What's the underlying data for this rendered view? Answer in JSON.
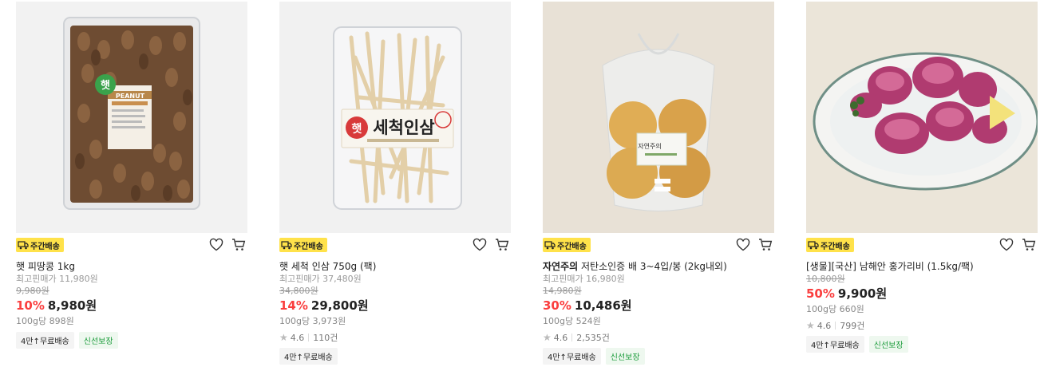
{
  "products": [
    {
      "delivery_badge": "주간배송",
      "brand": "",
      "name": "햇 피땅콩 1kg",
      "lowest_price_label": "최고핀매가 11,980원",
      "original_price": "9,980원",
      "discount_rate": "10%",
      "sale_price": "8,980원",
      "unit_price": "100g당 898원",
      "rating": "",
      "review_count": "",
      "tags": [
        "4만↑무료배송",
        "신선보장"
      ]
    },
    {
      "delivery_badge": "주간배송",
      "brand": "",
      "name": "햇 세척 인삼 750g (팩)",
      "lowest_price_label": "최고핀매가 37,480원",
      "original_price": "34,800원",
      "discount_rate": "14%",
      "sale_price": "29,800원",
      "unit_price": "100g당 3,973원",
      "rating": "4.6",
      "review_count": "110건",
      "tags": [
        "4만↑무료배송"
      ]
    },
    {
      "delivery_badge": "주간배송",
      "brand": "자연주의",
      "name": " 저탄소인증 배 3~4입/봉 (2kg내외)",
      "lowest_price_label": "최고핀매가 16,980원",
      "original_price": "14,980원",
      "discount_rate": "30%",
      "sale_price": "10,486원",
      "unit_price": "100g당 524원",
      "rating": "4.6",
      "review_count": "2,535건",
      "tags": [
        "4만↑무료배송",
        "신선보장"
      ]
    },
    {
      "delivery_badge": "주간배송",
      "brand": "",
      "name": "[생물][국산] 남해안 홍가리비 (1.5kg/팩)",
      "lowest_price_label": "",
      "original_price": "10,800원",
      "discount_rate": "50%",
      "sale_price": "9,900원",
      "unit_price": "100g당 660원",
      "rating": "4.6",
      "review_count": "799건",
      "tags": [
        "4만↑무료배송",
        "신선보장"
      ]
    }
  ],
  "image_text": {
    "peanut_sticker_ko": "햇",
    "peanut_sticker_en": "PEANUT",
    "ginseng_label": "세척인삼",
    "ginseng_seal": "햇",
    "pear_label": "자연주의"
  },
  "icons": {
    "badge": "truck-icon",
    "wishlist": "heart-icon",
    "cart": "cart-icon",
    "rating": "star-icon"
  },
  "colors": {
    "badge_bg": "#ffe24a",
    "discount": "#fa3e3e",
    "fresh_tag": "#1a9b3a"
  }
}
